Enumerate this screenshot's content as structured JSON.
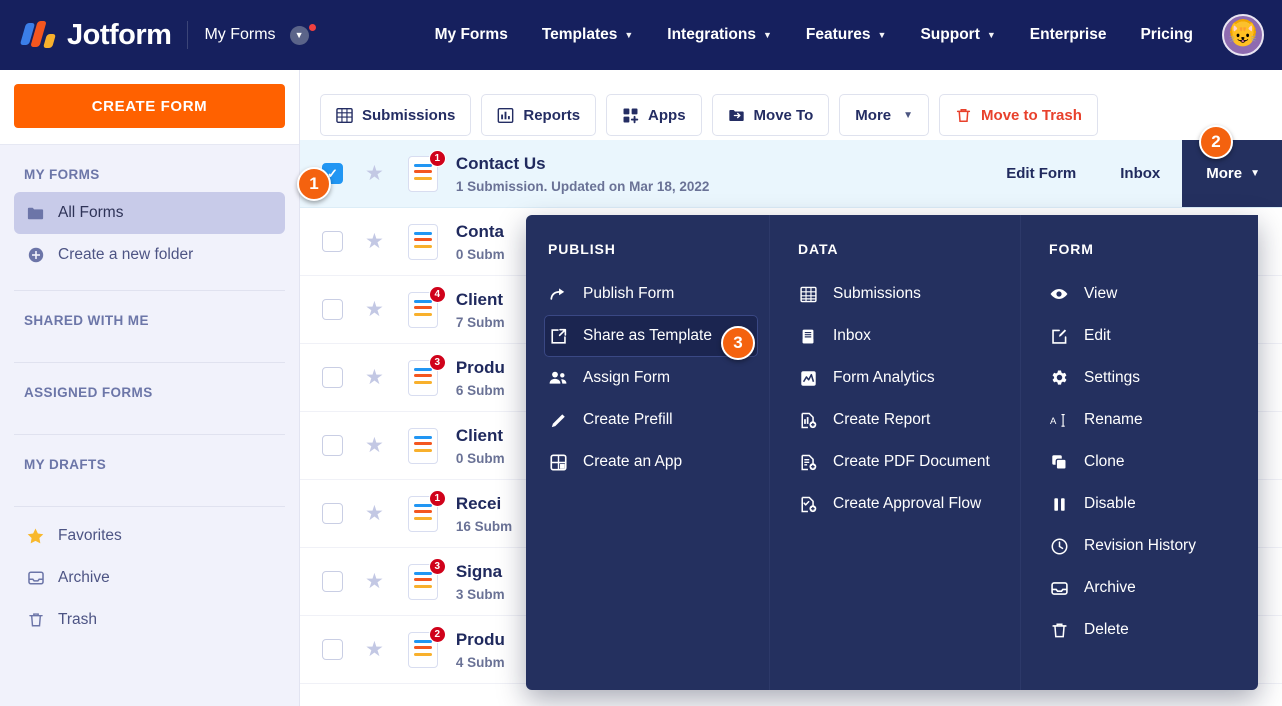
{
  "header": {
    "brand": "Jotform",
    "workspace": "My Forms",
    "nav": [
      {
        "label": "My Forms",
        "caret": false
      },
      {
        "label": "Templates",
        "caret": true
      },
      {
        "label": "Integrations",
        "caret": true
      },
      {
        "label": "Features",
        "caret": true
      },
      {
        "label": "Support",
        "caret": true
      },
      {
        "label": "Enterprise",
        "caret": false
      },
      {
        "label": "Pricing",
        "caret": false
      }
    ],
    "avatar_glyph": "😺",
    "background": "#16205e"
  },
  "sidebar": {
    "create_button": "CREATE FORM",
    "create_color": "#ff6100",
    "sections": [
      {
        "heading": "MY FORMS"
      },
      {
        "heading": "SHARED WITH ME"
      },
      {
        "heading": "ASSIGNED FORMS"
      },
      {
        "heading": "MY DRAFTS"
      }
    ],
    "my_forms_items": [
      {
        "label": "All Forms",
        "icon": "folder-icon",
        "active": true
      },
      {
        "label": "Create a new folder",
        "icon": "plus-circle-icon",
        "active": false
      }
    ],
    "bottom_items": [
      {
        "label": "Favorites",
        "icon": "star-icon"
      },
      {
        "label": "Archive",
        "icon": "archive-icon"
      },
      {
        "label": "Trash",
        "icon": "trash-icon"
      }
    ]
  },
  "toolbar": {
    "buttons": [
      {
        "label": "Submissions",
        "icon": "grid-table-icon",
        "danger": false,
        "caret": false
      },
      {
        "label": "Reports",
        "icon": "bar-chart-icon",
        "danger": false,
        "caret": false
      },
      {
        "label": "Apps",
        "icon": "apps-grid-icon",
        "danger": false,
        "caret": false
      },
      {
        "label": "Move To",
        "icon": "folder-arrow-icon",
        "danger": false,
        "caret": false
      },
      {
        "label": "More",
        "icon": "",
        "danger": false,
        "caret": true
      },
      {
        "label": "Move to Trash",
        "icon": "trash-red-icon",
        "danger": true,
        "caret": false
      }
    ],
    "danger_color": "#e8412c"
  },
  "form_list": {
    "rows": [
      {
        "title": "Contact Us",
        "sub": "1 Submission. Updated on Mar 18, 2022",
        "badge": "1",
        "checked": true,
        "selected": true
      },
      {
        "title": "Conta",
        "sub": "0 Subm",
        "badge": "",
        "checked": false,
        "selected": false
      },
      {
        "title": "Client",
        "sub": "7 Subm",
        "badge": "4",
        "checked": false,
        "selected": false
      },
      {
        "title": "Produ",
        "sub": "6 Subm",
        "badge": "3",
        "checked": false,
        "selected": false
      },
      {
        "title": "Client",
        "sub": "0 Subm",
        "badge": "",
        "checked": false,
        "selected": false
      },
      {
        "title": "Recei",
        "sub": "16 Subm",
        "badge": "1",
        "checked": false,
        "selected": false
      },
      {
        "title": "Signa",
        "sub": "3 Subm",
        "badge": "3",
        "checked": false,
        "selected": false
      },
      {
        "title": "Produ",
        "sub": "4 Subm",
        "badge": "2",
        "checked": false,
        "selected": false
      }
    ],
    "row_actions": [
      {
        "label": "Edit Form",
        "kind": "plain"
      },
      {
        "label": "Inbox",
        "kind": "plain"
      },
      {
        "label": "More",
        "kind": "more"
      }
    ],
    "checkbox_color": "#2196f3",
    "badge_color": "#d0021b"
  },
  "menu": {
    "background": "#24305f",
    "columns": [
      {
        "title": "PUBLISH",
        "items": [
          {
            "label": "Publish Form",
            "icon": "share-arrow-icon",
            "active": false
          },
          {
            "label": "Share as Template",
            "icon": "external-link-icon",
            "active": true
          },
          {
            "label": "Assign Form",
            "icon": "people-icon",
            "active": false
          },
          {
            "label": "Create Prefill",
            "icon": "pencil-icon",
            "active": false
          },
          {
            "label": "Create an App",
            "icon": "app-grid-plus-icon",
            "active": false
          }
        ]
      },
      {
        "title": "DATA",
        "items": [
          {
            "label": "Submissions",
            "icon": "grid-table-icon",
            "active": false
          },
          {
            "label": "Inbox",
            "icon": "inbox-icon",
            "active": false
          },
          {
            "label": "Form Analytics",
            "icon": "analytics-icon",
            "active": false
          },
          {
            "label": "Create Report",
            "icon": "report-plus-icon",
            "active": false
          },
          {
            "label": "Create PDF Document",
            "icon": "pdf-plus-icon",
            "active": false
          },
          {
            "label": "Create Approval Flow",
            "icon": "approval-plus-icon",
            "active": false
          }
        ]
      },
      {
        "title": "FORM",
        "items": [
          {
            "label": "View",
            "icon": "eye-icon",
            "active": false
          },
          {
            "label": "Edit",
            "icon": "edit-square-icon",
            "active": false
          },
          {
            "label": "Settings",
            "icon": "gear-icon",
            "active": false
          },
          {
            "label": "Rename",
            "icon": "text-cursor-icon",
            "active": false
          },
          {
            "label": "Clone",
            "icon": "clone-icon",
            "active": false
          },
          {
            "label": "Disable",
            "icon": "pause-icon",
            "active": false
          },
          {
            "label": "Revision History",
            "icon": "clock-icon",
            "active": false
          },
          {
            "label": "Archive",
            "icon": "archive-icon",
            "active": false
          },
          {
            "label": "Delete",
            "icon": "trash-icon",
            "active": false
          }
        ]
      }
    ]
  },
  "steps": [
    {
      "number": "1"
    },
    {
      "number": "2"
    },
    {
      "number": "3"
    }
  ],
  "step_color": "#f4620f"
}
